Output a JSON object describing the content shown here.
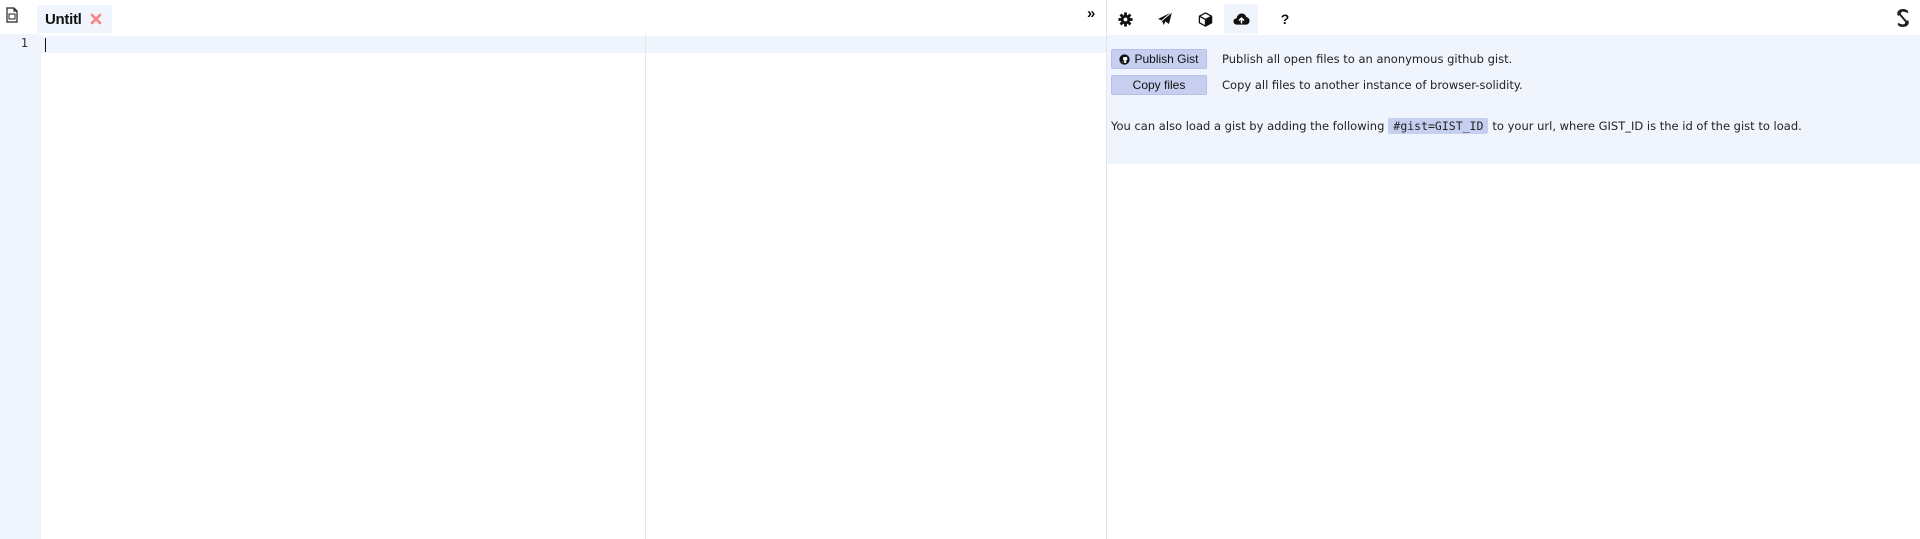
{
  "editor": {
    "tab_name": "Untitl",
    "line_number": "1",
    "collapse_label": "»"
  },
  "toolbar": {
    "icons": [
      "gear-icon",
      "paper-plane-icon",
      "cube-icon",
      "cloud-upload-icon",
      "question-icon"
    ],
    "help_label": "?"
  },
  "files_panel": {
    "publish_label": "Publish Gist",
    "publish_desc": "Publish all open files to an anonymous github gist.",
    "copy_label": "Copy files",
    "copy_desc": "Copy all files to another instance of browser-solidity.",
    "gist_prefix": "You can also load a gist by adding the following",
    "gist_code": "#gist=GIST_ID",
    "gist_suffix": "to your url, where GIST_ID is the id of the gist to load."
  },
  "colors": {
    "accent_bg": "#f0f4fc",
    "button_bg": "#c6cff0",
    "close_red": "#ff8080"
  }
}
